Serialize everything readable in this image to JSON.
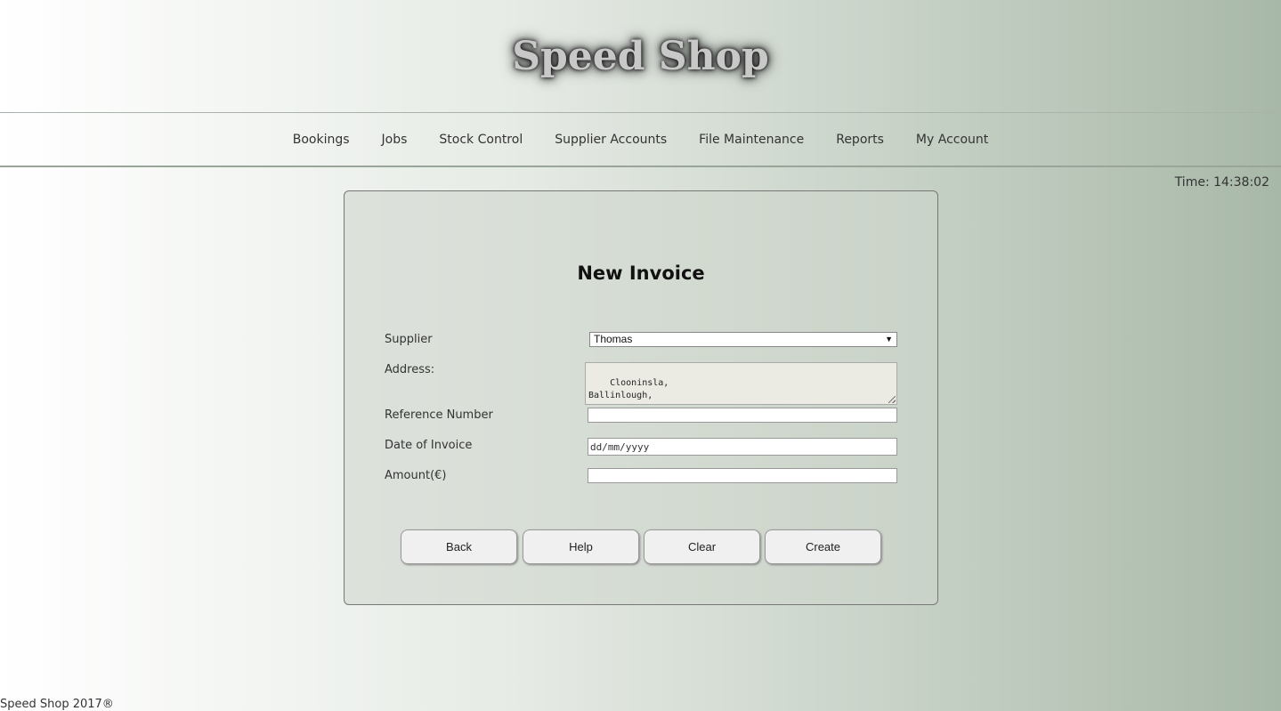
{
  "header": {
    "logo_text": "Speed Shop"
  },
  "nav": {
    "items": [
      {
        "label": "Bookings"
      },
      {
        "label": "Jobs"
      },
      {
        "label": "Stock Control"
      },
      {
        "label": "Supplier Accounts"
      },
      {
        "label": "File Maintenance"
      },
      {
        "label": "Reports"
      },
      {
        "label": "My Account"
      }
    ]
  },
  "status": {
    "time": "Time: 14:38:02"
  },
  "form": {
    "title": "New Invoice",
    "supplier_label": "Supplier",
    "supplier_value": "Thomas",
    "address_label": "Address:",
    "address_value": "Clooninsla,\nBallinlough,\nCo.Roscommon",
    "reference_label": "Reference Number",
    "reference_value": "",
    "date_label": "Date of Invoice",
    "date_placeholder": "dd/mm/yyyy",
    "amount_label": "Amount(€)",
    "amount_value": ""
  },
  "buttons": {
    "back": "Back",
    "help": "Help",
    "clear": "Clear",
    "create": "Create"
  },
  "footer": {
    "text": "Speed Shop 2017®"
  }
}
